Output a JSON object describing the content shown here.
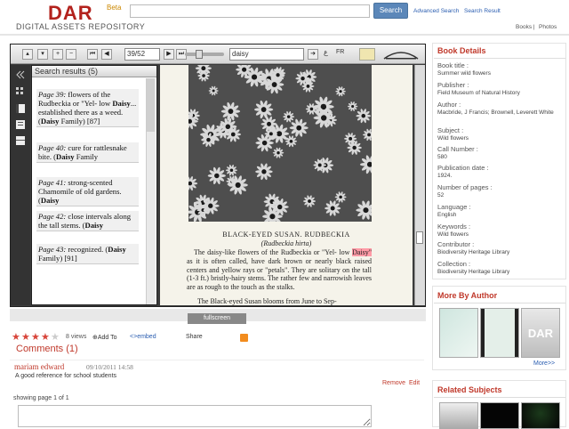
{
  "header": {
    "logo": "DAR",
    "beta": "Beta",
    "subtitle": "DIGITAL ASSETS REPOSITORY",
    "search_button": "Search",
    "advanced_search": "Advanced Search",
    "search_result": "Search Result",
    "books": "Books",
    "photos": "Photos",
    "separator": "|"
  },
  "viewer": {
    "page_value": "39/52",
    "find_value": "daisy",
    "fr_label": "FR",
    "ar_label": "ع",
    "results_title": "Search results (5)",
    "results": [
      {
        "page": "Page 39:",
        "pre": " flowers of the Rudbeckia or \"Yel- low ",
        "hit": "Daisy",
        "post": "... established there as a weed. (",
        "hit2": "Daisy",
        "post2": " Family) [87]"
      },
      {
        "page": "Page 40:",
        "pre": " cure for rattlesnake bite. (",
        "hit": "Daisy",
        "post": " Family",
        "hit2": "",
        "post2": ""
      },
      {
        "page": "Page 41:",
        "pre": " strong-scented Chamomile of old gardens. (",
        "hit": "Daisy",
        "post": "",
        "hit2": "",
        "post2": ""
      },
      {
        "page": "Page 42:",
        "pre": " close intervals along the tall stems. (",
        "hit": "Daisy",
        "post": "",
        "hit2": "",
        "post2": ""
      },
      {
        "page": "Page 43:",
        "pre": " recognized. (",
        "hit": "Daisy",
        "post": " Family) [91]",
        "hit2": "",
        "post2": ""
      }
    ],
    "page_caption": "BLACK-EYED SUSAN.   RUDBECKIA",
    "page_latin": "(Rudbeckia hirta)",
    "page_body_pre": "The daisy-like flowers of the Rudbeckia or \"Yel- low ",
    "page_body_hit": "Daisy\"",
    "page_body_post": " as it is often called, have dark brown or nearly black raised centers and yellow rays or \"petals\". They are solitary on the tall (1-3 ft.) bristly-hairy stems. The rather few and narrowish leaves are as rough to the touch as the stalks.",
    "page_body2": "The Black-eyed Susan blooms from June to Sep-",
    "fullscreen": "fullscreen"
  },
  "actions": {
    "rating": 4,
    "views": "8 views",
    "add_to": "Add To",
    "embed": "embed",
    "share": "Share"
  },
  "comments": {
    "title": "Comments (1)",
    "author": "mariam edward",
    "date": "09/10/2011 14:58",
    "text": "A good reference for school students",
    "remove": "Remove",
    "edit": "Edit",
    "showing": "showing page 1 of 1"
  },
  "details": {
    "title": "Book Details",
    "fields": [
      {
        "label": "Book title :",
        "value": "Summer wild flowers"
      },
      {
        "label": "Publisher :",
        "value": "Field Museum of Natural History"
      },
      {
        "label": "Author :",
        "value": "Macbride, J Francis; Brownell, Leverett White"
      },
      {
        "label": "Subject :",
        "value": "Wild flowers"
      },
      {
        "label": "Call Number :",
        "value": "580"
      },
      {
        "label": "Publication date :",
        "value": "1924."
      },
      {
        "label": "Number of pages :",
        "value": "52"
      },
      {
        "label": "Language :",
        "value": "English"
      },
      {
        "label": "Keywords :",
        "value": "Wild flowers"
      },
      {
        "label": "Contributor :",
        "value": "Biodiversity Heritage Library"
      },
      {
        "label": "Collection :",
        "value": "Biodiversity Heritage Library"
      }
    ]
  },
  "more_by_author": {
    "title": "More By Author",
    "more": "More>>",
    "thumb_logo": "DAR"
  },
  "related": {
    "title": "Related Subjects"
  },
  "colors": {
    "brand_red": "#b3221d",
    "accent_red": "#c0392b",
    "link_blue": "#2a5db0",
    "search_blue": "#5b87b9"
  }
}
